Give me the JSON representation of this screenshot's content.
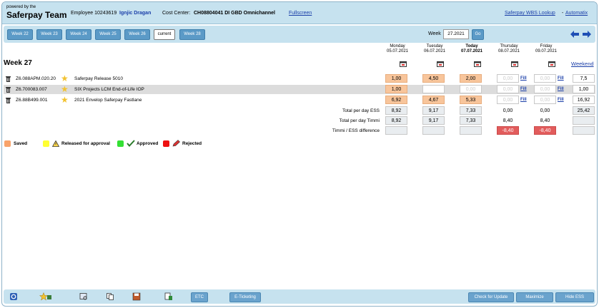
{
  "header": {
    "powered_by": "powered by the",
    "team": "Saferpay Team",
    "employee_label": "Employee 10243619",
    "employee_name": "Ignjic Dragan",
    "cost_center_label": "Cost Center:",
    "cost_center_value": "CH08804041  DI GBD Omnichannel",
    "fullscreen": "Fullscreen",
    "wbs_lookup": "Saferpay WBS Lookup",
    "sep": "-",
    "automatix": "Automatix"
  },
  "weeks": {
    "buttons": [
      "Week 22",
      "Week 23",
      "Week 24",
      "Week 25",
      "Week 26",
      "current",
      "Week 28"
    ],
    "week_label": "Week",
    "week_value": "27.2021",
    "go": "Go"
  },
  "title": "Week 27",
  "days": [
    {
      "name": "Monday",
      "date": "05.07.2021"
    },
    {
      "name": "Tuesday",
      "date": "06.07.2021"
    },
    {
      "name": "Today",
      "date": "07.07.2021"
    },
    {
      "name": "Thursday",
      "date": "08.07.2021"
    },
    {
      "name": "Friday",
      "date": "09.07.2021"
    }
  ],
  "weekend": "Weekend",
  "rows": [
    {
      "code": "Z6.088APM.020.20",
      "name": "Saferpay Release 5010",
      "values": [
        "1,00",
        "4,50",
        "2,00",
        "0,00",
        "0,00"
      ],
      "total": "7,5"
    },
    {
      "code": "Z6.700083.007",
      "name": "SIX Projects LCM End-of-Life IOP",
      "values": [
        "1,00",
        "",
        "0,00",
        "0,00",
        "0,00"
      ],
      "total": "1,00"
    },
    {
      "code": "Z6.88B499.001",
      "name": "2021 Envelop Saferpay Fastlane",
      "values": [
        "6,92",
        "4,67",
        "5,33",
        "0,00",
        "0,00"
      ],
      "total": "16,92"
    }
  ],
  "fill_label": "Fill",
  "summary": [
    {
      "label": "Total per day ESS",
      "values": [
        "8,92",
        "9,17",
        "7,33",
        "0,00",
        "0,00"
      ],
      "total": "25,42"
    },
    {
      "label": "Total per day Timmi",
      "values": [
        "8,92",
        "9,17",
        "7,33",
        "8,40",
        "8,40"
      ],
      "total": ""
    },
    {
      "label": "Timmi / ESS difference",
      "values": [
        "",
        "",
        "",
        "-8,40",
        "-8,40"
      ],
      "total": ""
    }
  ],
  "legend": {
    "saved": "Saved",
    "released": "Released for approval",
    "approved": "Approved",
    "rejected": "Rejected"
  },
  "footer": {
    "etc": "ETC",
    "eticketing": "E-Ticketing",
    "check_update": "Check for Update",
    "maximize": "Maximize",
    "hide": "Hide ESS"
  },
  "colors": {
    "saved": "#f8a36b",
    "released": "#ffff33",
    "approved": "#33e033",
    "rejected": "#ee1111"
  }
}
